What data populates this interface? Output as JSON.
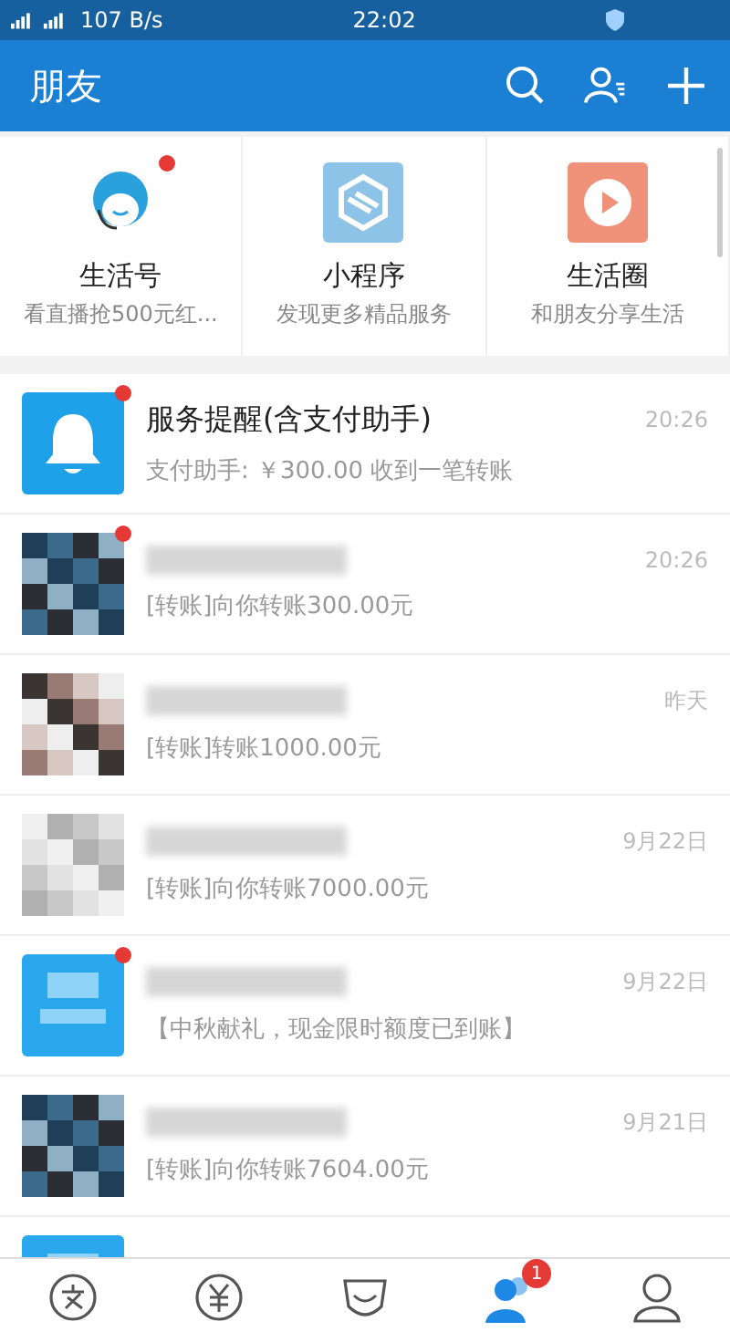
{
  "status_bar": {
    "speed": "107 B/s",
    "time": "22:02"
  },
  "header": {
    "title": "朋友"
  },
  "shortcuts": [
    {
      "kind": "headset",
      "title": "生活号",
      "subtitle": "看直播抢500元红...",
      "unread": true
    },
    {
      "kind": "hexagon",
      "title": "小程序",
      "subtitle": "发现更多精品服务",
      "unread": false
    },
    {
      "kind": "play",
      "title": "生活圈",
      "subtitle": "和朋友分享生活",
      "unread": false
    }
  ],
  "conversations": [
    {
      "kind": "bell",
      "name": "服务提醒(含支付助手)",
      "message": "支付助手: ￥300.00 收到一笔转账",
      "time": "20:26",
      "unread": true
    },
    {
      "message": "[转账]向你转账300.00元",
      "time": "20:26",
      "unread": true
    },
    {
      "message": "[转账]转账1000.00元",
      "time": "昨天",
      "unread": false
    },
    {
      "message": "[转账]向你转账7000.00元",
      "time": "9月22日",
      "unread": false
    },
    {
      "kind": "logo",
      "message": "【中秋献礼，现金限时额度已到账】",
      "time": "9月22日",
      "unread": true
    },
    {
      "message": "[转账]向你转账7604.00元",
      "time": "9月21日",
      "unread": false
    },
    {
      "kind": "logo",
      "unread": false
    }
  ],
  "tab_bar": [
    {
      "kind": "home",
      "selected": false
    },
    {
      "kind": "wealth",
      "selected": false
    },
    {
      "kind": "koubei",
      "selected": false
    },
    {
      "kind": "friends",
      "selected": true,
      "badge": "1"
    },
    {
      "kind": "me",
      "selected": false
    }
  ]
}
